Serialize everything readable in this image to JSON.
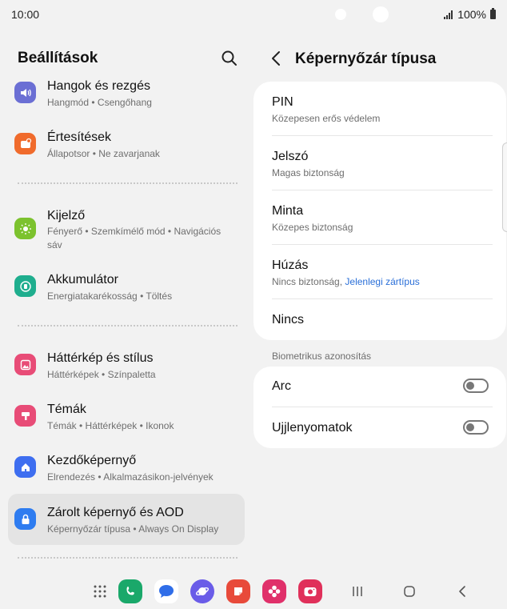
{
  "status_bar": {
    "time": "10:00",
    "battery": "100%"
  },
  "left_pane": {
    "title": "Beállítások",
    "items": [
      {
        "title": "Hangok és rezgés",
        "subtitle": "Hangmód  •  Csengőhang",
        "icon": "sound-icon",
        "color": "#6b6fd4"
      },
      {
        "title": "Értesítések",
        "subtitle": "Állapotsor  •  Ne zavarjanak",
        "icon": "notification-icon",
        "color": "#f06b2c"
      },
      {
        "title": "Kijelző",
        "subtitle": "Fényerő  •  Szemkímélő mód  •  Navigációs sáv",
        "icon": "brightness-icon",
        "color": "#7cc22e"
      },
      {
        "title": "Akkumulátor",
        "subtitle": "Energiatakarékosság  •  Töltés",
        "icon": "battery-icon",
        "color": "#1fae8e"
      },
      {
        "title": "Háttérkép és stílus",
        "subtitle": "Háttérképek  •  Színpaletta",
        "icon": "wallpaper-icon",
        "color": "#e84c77"
      },
      {
        "title": "Témák",
        "subtitle": "Témák  •  Háttérképek  •  Ikonok",
        "icon": "themes-icon",
        "color": "#e84c77"
      },
      {
        "title": "Kezdőképernyő",
        "subtitle": "Elrendezés  •  Alkalmazásikon-jelvények",
        "icon": "home-screen-icon",
        "color": "#3e6ef0"
      },
      {
        "title": "Zárolt képernyő és AOD",
        "subtitle": "Képernyőzár típusa  •  Always On Display",
        "icon": "lock-icon",
        "color": "#2e7cf0"
      }
    ]
  },
  "right_pane": {
    "title": "Képernyőzár típusa",
    "options": [
      {
        "title": "PIN",
        "subtitle": "Közepesen erős védelem"
      },
      {
        "title": "Jelszó",
        "subtitle": "Magas biztonság"
      },
      {
        "title": "Minta",
        "subtitle": "Közepes biztonság"
      },
      {
        "title": "Húzás",
        "subtitle": "Nincs biztonság, ",
        "subtitle_highlight": "Jelenlegi zártípus"
      },
      {
        "title": "Nincs"
      }
    ],
    "biometrics_label": "Biometrikus azonosítás",
    "biometrics": [
      {
        "title": "Arc",
        "enabled": false
      },
      {
        "title": "Ujjlenyomatok",
        "enabled": false
      }
    ]
  },
  "taskbar": {
    "apps": [
      {
        "name": "phone-app-icon",
        "color": "#1aa86a"
      },
      {
        "name": "messages-app-icon",
        "color": "#2f6de8"
      },
      {
        "name": "internet-app-icon",
        "color": "#6a5ce8"
      },
      {
        "name": "notes-app-icon",
        "color": "#e84a3a"
      },
      {
        "name": "gallery-app-icon",
        "color": "#e0306a"
      },
      {
        "name": "camera-app-icon",
        "color": "#e0305a"
      }
    ]
  }
}
